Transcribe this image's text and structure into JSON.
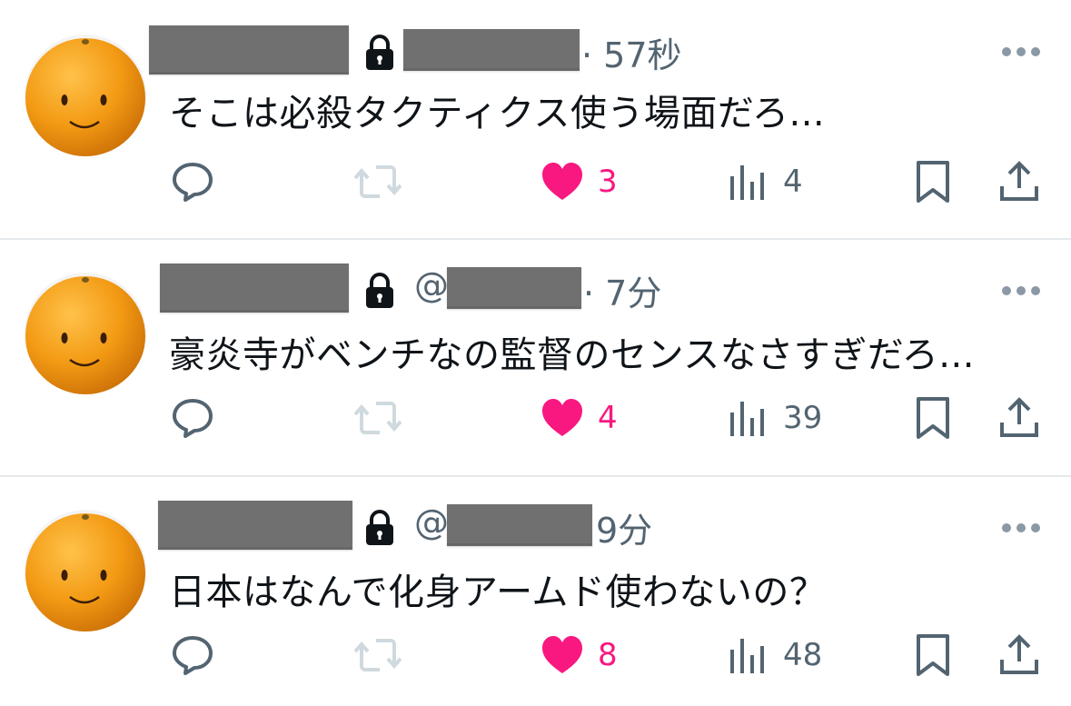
{
  "tweets": [
    {
      "has_at_symbol": false,
      "at_symbol": "",
      "time": "· 57秒",
      "text": "そこは必殺タクティクス使う場面だろ...",
      "reply_count": "",
      "retweet_count": "",
      "like_count": "3",
      "view_count": "4",
      "liked": true
    },
    {
      "has_at_symbol": true,
      "at_symbol": "@",
      "time": "· 7分",
      "text": "豪炎寺がベンチなの監督のセンスなさすぎだろ...",
      "reply_count": "",
      "retweet_count": "",
      "like_count": "4",
      "view_count": "39",
      "liked": true
    },
    {
      "has_at_symbol": true,
      "at_symbol": "@",
      "time": "9分",
      "text": "日本はなんで化身アームド使わないの？",
      "reply_count": "",
      "retweet_count": "",
      "like_count": "8",
      "view_count": "48",
      "liked": true
    }
  ],
  "colors": {
    "like": "#f91880",
    "icon": "#536471",
    "retweet_disabled": "#cfd9de",
    "redaction": "#707070",
    "divider": "#e6e9ec"
  },
  "icons": [
    "lock-icon",
    "more-icon",
    "reply-icon",
    "retweet-icon",
    "heart-icon",
    "views-icon",
    "bookmark-icon",
    "share-icon"
  ]
}
